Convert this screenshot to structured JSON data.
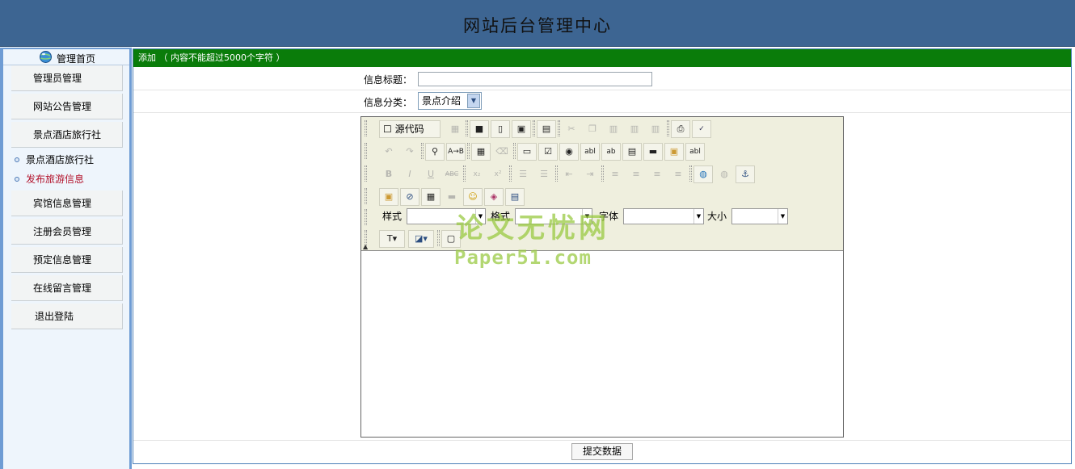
{
  "header": {
    "title": "网站后台管理中心"
  },
  "sidebar": {
    "home_label": "管理首页",
    "menu": [
      {
        "label": "管理员管理"
      },
      {
        "label": "网站公告管理"
      },
      {
        "label": "景点酒店旅行社"
      }
    ],
    "submenu": [
      {
        "label": "景点酒店旅行社"
      },
      {
        "label": "发布旅游信息"
      }
    ],
    "menu2": [
      {
        "label": "宾馆信息管理"
      },
      {
        "label": "注册会员管理"
      },
      {
        "label": "预定信息管理"
      },
      {
        "label": "在线留言管理"
      },
      {
        "label": "退出登陆"
      }
    ],
    "colors": {
      "active_sub": "#b2112a",
      "frame": "#6e9cd4"
    }
  },
  "form": {
    "bar_text": "添加 （ 内容不能超过5000个字符 ）",
    "title_label": "信息标题：",
    "title_value": "",
    "category_label": "信息分类：",
    "category_value": "景点介绍",
    "submit_label": "提交数据",
    "bar_color": "#0a7c0a"
  },
  "editor": {
    "source_label": "源代码",
    "style_label": "样式",
    "format_label": "格式",
    "font_label": "字体",
    "size_label": "大小",
    "content": ""
  },
  "watermark": {
    "line1": "论文无忧网",
    "line2": "Paper51.com"
  }
}
